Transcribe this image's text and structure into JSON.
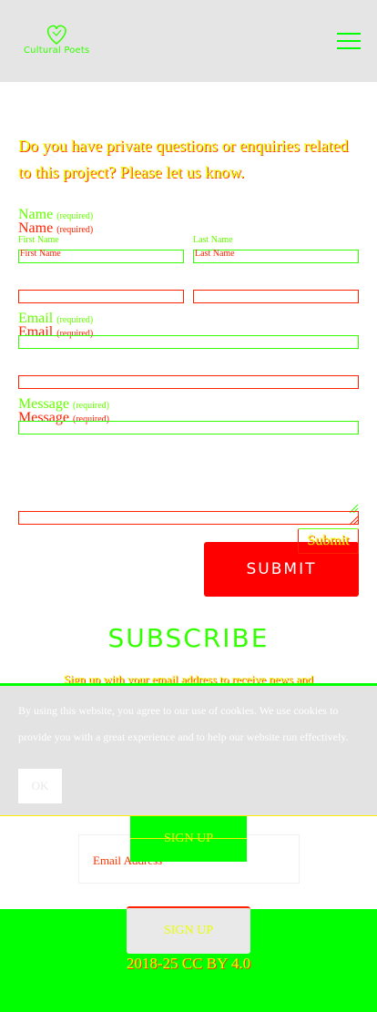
{
  "header": {
    "logo_text": "Cultural Poets",
    "menu_icon": "hamburger-menu-icon"
  },
  "intro": {
    "text": "Do you have private questions or enquiries related to this project? Please let us know."
  },
  "form": {
    "name": {
      "label": "Name",
      "required": "(required)",
      "first_label": "First Name",
      "last_label": "Last Name",
      "first_placeholder": "First Name",
      "last_placeholder": "Last Name"
    },
    "email": {
      "label": "Email",
      "required": "(required)"
    },
    "message": {
      "label": "Message",
      "required": "(required)"
    },
    "submit_small": "Submit",
    "submit_big": "SUBMIT"
  },
  "subscribe": {
    "title": "SUBSCRIBE",
    "text": "Sign up with your email address to receive news and",
    "email_placeholder": "Email Address",
    "button": "SIGN UP"
  },
  "cookie": {
    "text": "By using this website, you agree to our use of cookies. We use cookies to provide you with a great experience and to help our website run effectively.",
    "ok": "OK"
  },
  "footer": {
    "signup": "SIGN UP",
    "copyright": "2018-25 CC BY 4.0"
  },
  "colors": {
    "accent_green": "#00ff00",
    "submit_red": "#ff0000",
    "header_gray": "#e5e5e5"
  }
}
